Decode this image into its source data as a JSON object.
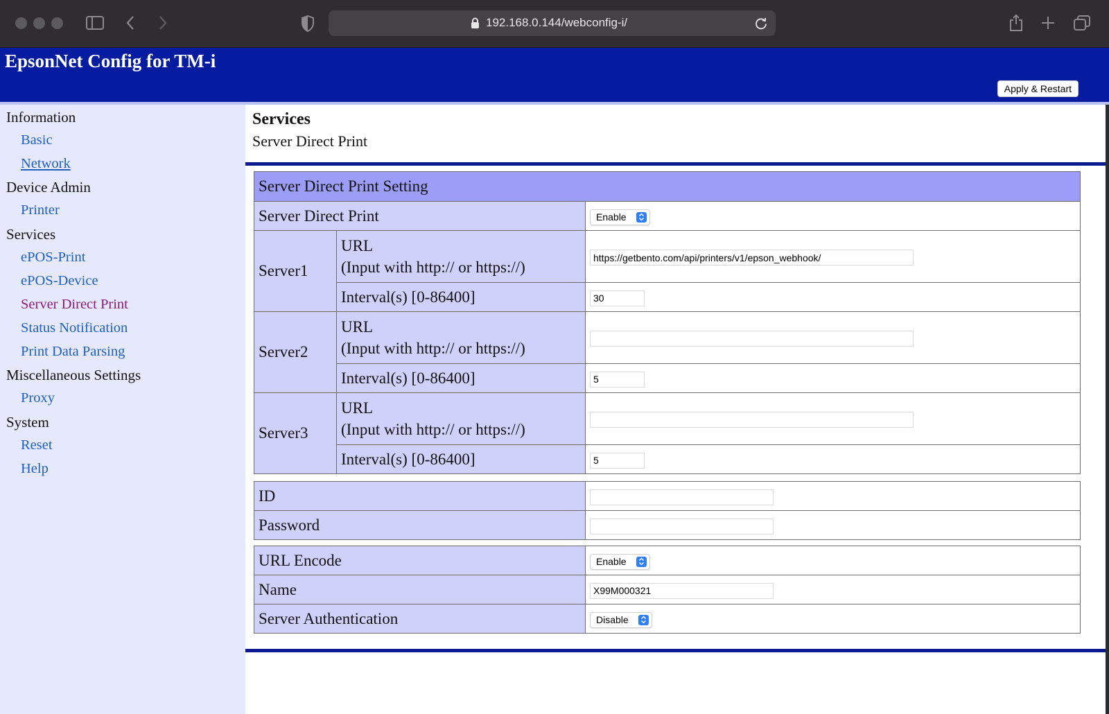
{
  "browser": {
    "address": "192.168.0.144/webconfig-i/"
  },
  "header": {
    "title": "EpsonNet Config for TM-i",
    "apply_button": "Apply & Restart"
  },
  "sidebar": {
    "groups": [
      {
        "label": "Information",
        "items": [
          "Basic",
          "Network"
        ]
      },
      {
        "label": "Device Admin",
        "items": [
          "Printer"
        ]
      },
      {
        "label": "Services",
        "items": [
          "ePOS-Print",
          "ePOS-Device",
          "Server Direct Print",
          "Status Notification",
          "Print Data Parsing"
        ]
      },
      {
        "label": "Miscellaneous Settings",
        "items": [
          "Proxy"
        ]
      },
      {
        "label": "System",
        "items": [
          "Reset",
          "Help"
        ]
      }
    ]
  },
  "main": {
    "section": "Services",
    "subsection": "Server Direct Print",
    "table_title": "Server Direct Print Setting",
    "sdp_label": "Server Direct Print",
    "sdp_value": "Enable",
    "url_label_line1": "URL",
    "url_label_line2": "(Input with http:// or https://)",
    "interval_label": "Interval(s) [0-86400]",
    "servers": [
      {
        "name": "Server1",
        "url": "https://getbento.com/api/printers/v1/epson_webhook/",
        "interval": "30"
      },
      {
        "name": "Server2",
        "url": "",
        "interval": "5"
      },
      {
        "name": "Server3",
        "url": "",
        "interval": "5"
      }
    ],
    "id_label": "ID",
    "id_value": "",
    "password_label": "Password",
    "password_value": "",
    "url_encode_label": "URL Encode",
    "url_encode_value": "Enable",
    "name_label": "Name",
    "name_value": "X99M000321",
    "server_auth_label": "Server Authentication",
    "server_auth_value": "Disable"
  },
  "colors": {
    "header_bg": "#061ca0",
    "sidebar_bg": "#e6e9fb",
    "table_header_bg": "#9b9df7",
    "label_bg": "#cfd1fb",
    "link": "#1f5fbd",
    "visited_link": "#8a1a7a"
  }
}
